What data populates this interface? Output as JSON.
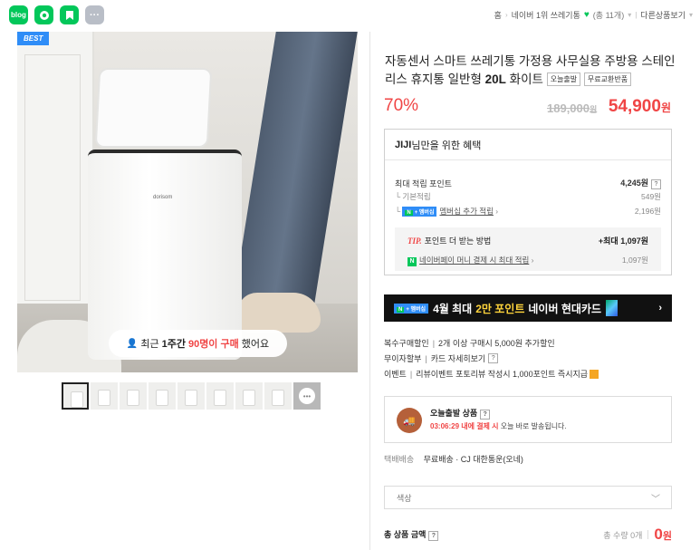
{
  "share_icons": [
    {
      "name": "blog-share-icon",
      "label": "blog"
    },
    {
      "name": "talk-share-icon",
      "label": ""
    },
    {
      "name": "bookmark-share-icon",
      "label": ""
    },
    {
      "name": "more-share-icon",
      "label": "···"
    }
  ],
  "breadcrumb": {
    "home": "홈",
    "ranking": "네이버 1위 쓰레기통",
    "count": "(총 11개)",
    "other": "다른상품보기"
  },
  "gallery": {
    "badge": "BEST",
    "brand_print": "dorisom",
    "caption_prefix": "최근",
    "caption_week": "1주간",
    "caption_count": "90명이 구매",
    "caption_suffix": "했어요",
    "thumb_count": 10
  },
  "product": {
    "title": "자동센서 스마트 쓰레기통 가정용 사무실용 주방용 스테인리스 휴지통 일반형",
    "title_bold": "20L",
    "title_tail": "화이트",
    "tags": [
      "오늘출발",
      "무료교환반품"
    ],
    "discount": "70%",
    "original_price": "189,000",
    "original_unit": "원",
    "sale_price": "54,900",
    "sale_unit": "원"
  },
  "benefits": {
    "head_user": "JIJI",
    "head_text": "님만을 위한 혜택",
    "max_points_label": "최대 적립 포인트",
    "max_points_value": "4,245원",
    "basic_label": "기본적립",
    "basic_value": "549원",
    "membership_badge": "멤버십",
    "membership_label": "멤버십 추가 적립",
    "membership_value": "2,196원",
    "tip_tag": "TIP.",
    "tip_label": "포인트 더 받는 방법",
    "tip_value": "+최대 1,097원",
    "npay_label": "네이버페이 머니 결제 시 최대 적립",
    "npay_value": "1,097원"
  },
  "card_banner": {
    "badge": "멤버십",
    "text_a": "4월 최대",
    "text_b": "2만 포인트",
    "text_c": "네이버 현대카드"
  },
  "info": {
    "multi_label": "복수구매할인",
    "multi_text": "2개 이상 구매시 5,000원 추가할인",
    "installment_label": "무이자할부",
    "installment_text": "카드 자세히보기",
    "event_label": "이벤트",
    "event_text": "리뷰이벤트 포토리뷰 작성시 1,000포인트 즉시지급"
  },
  "delivery": {
    "title": "오늘출발 상품",
    "time": "03:06:29 내에 결제 시",
    "rest": "오늘 바로 발송됩니다."
  },
  "shipping": {
    "label": "택배배송",
    "text": "무료배송 · CJ 대한통운(오네)"
  },
  "option_select": {
    "placeholder": "색상"
  },
  "total": {
    "label": "총 상품 금액",
    "qty": "총 수량 0개",
    "price": "0",
    "unit": "원"
  },
  "colors": {
    "accent_red": "#f04545",
    "naver_green": "#03c75a",
    "membership_blue": "#2f8df7"
  }
}
